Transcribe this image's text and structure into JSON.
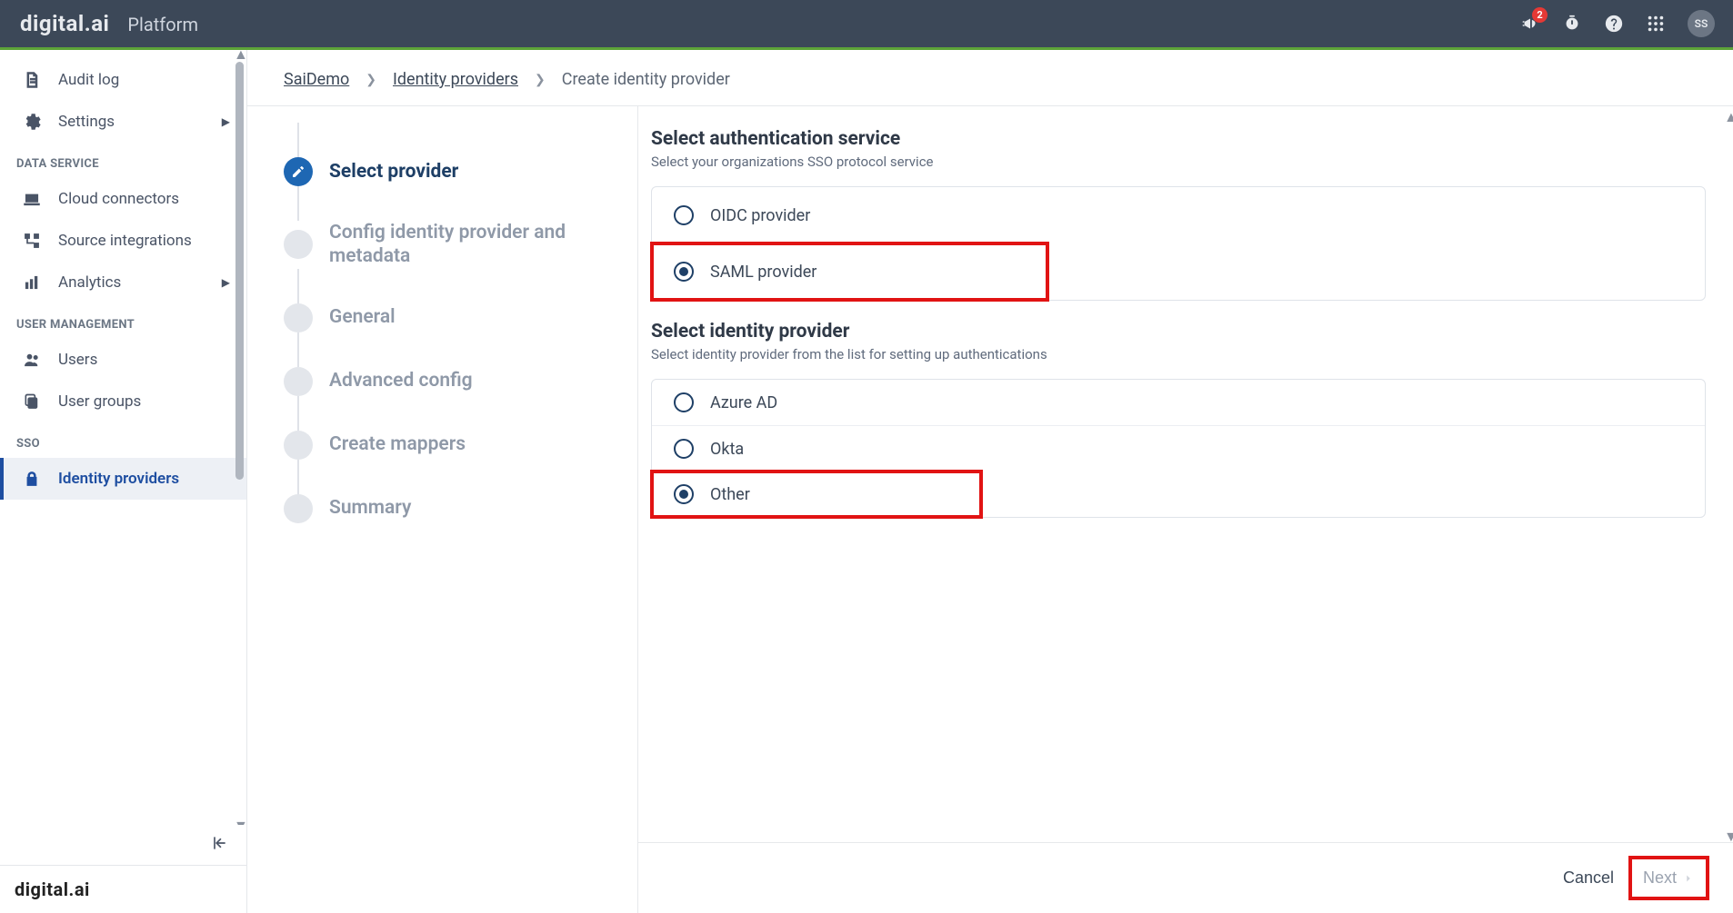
{
  "header": {
    "brand": "digital.ai",
    "platform": "Platform",
    "notification_count": "2",
    "avatar_initials": "SS"
  },
  "sidebar": {
    "items": [
      {
        "label": "Audit log"
      },
      {
        "label": "Settings"
      }
    ],
    "section_data": "DATA SERVICE",
    "data_items": [
      {
        "label": "Cloud connectors"
      },
      {
        "label": "Source integrations"
      },
      {
        "label": "Analytics"
      }
    ],
    "section_user": "USER MANAGEMENT",
    "user_items": [
      {
        "label": "Users"
      },
      {
        "label": "User groups"
      }
    ],
    "section_sso": "SSO",
    "sso_items": [
      {
        "label": "Identity providers"
      }
    ],
    "footer_brand": "digital.ai"
  },
  "breadcrumb": {
    "items": [
      {
        "label": "SaiDemo"
      },
      {
        "label": "Identity providers"
      },
      {
        "label": "Create identity provider"
      }
    ]
  },
  "wizard": {
    "steps": [
      "Select provider",
      "Config identity provider and metadata",
      "General",
      "Advanced config",
      "Create mappers",
      "Summary"
    ]
  },
  "form": {
    "auth_title": "Select authentication service",
    "auth_sub": "Select your organizations SSO protocol service",
    "auth_options": [
      {
        "label": "OIDC provider"
      },
      {
        "label": "SAML provider"
      }
    ],
    "idp_title": "Select identity provider",
    "idp_sub": "Select identity provider from the list for setting up authentications",
    "idp_options": [
      {
        "label": "Azure AD"
      },
      {
        "label": "Okta"
      },
      {
        "label": "Other"
      }
    ]
  },
  "footer": {
    "cancel": "Cancel",
    "next": "Next"
  }
}
